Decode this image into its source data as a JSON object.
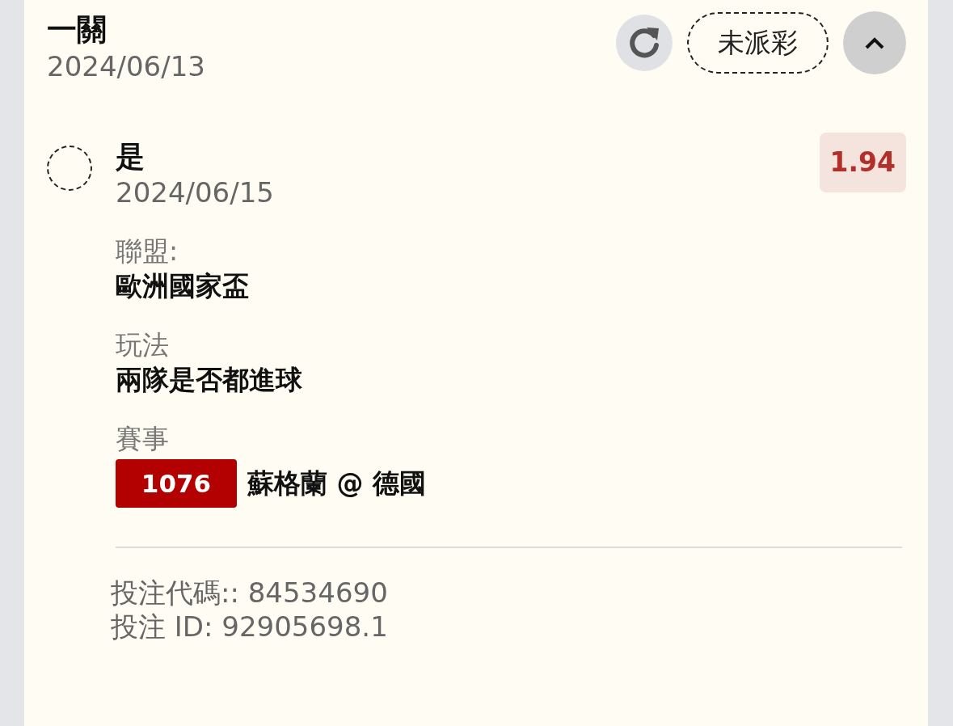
{
  "bet": {
    "title": "一關",
    "date": "2024/06/13",
    "status": "未派彩",
    "expanded": true
  },
  "selection": {
    "selected": false,
    "name": "是",
    "date": "2024/06/15",
    "odds": "1.94"
  },
  "details": [
    {
      "label": "聯盟:",
      "value": "歐洲國家盃"
    },
    {
      "label": "玩法",
      "value": "兩隊是否都進球"
    }
  ],
  "event": {
    "label": "賽事",
    "number": "1076",
    "match": "蘇格蘭 @ 德國"
  },
  "footer": [
    "投注代碼:: 84534690",
    "投注 ID: 92905698.1"
  ]
}
